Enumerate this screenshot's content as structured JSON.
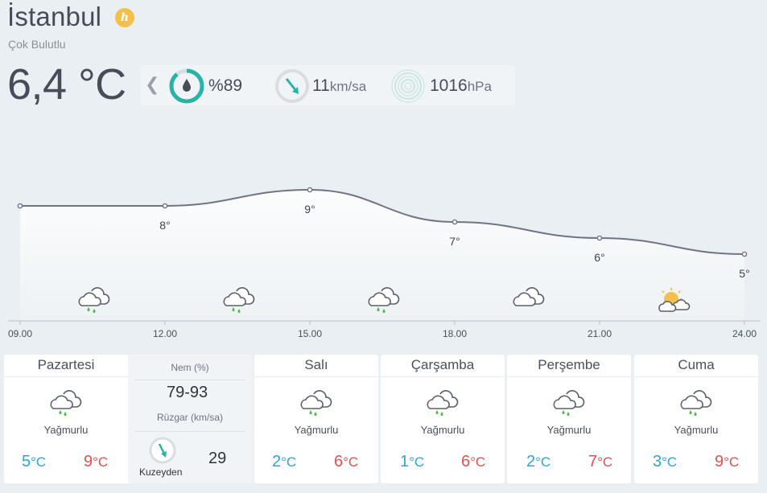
{
  "header": {
    "city": "İstanbul",
    "badge_letter": "h",
    "condition": "Çok Bulutlu",
    "temperature": "6,4 °C"
  },
  "stats": {
    "humidity": {
      "prefix": "%",
      "value": "89",
      "level": 0.89
    },
    "wind": {
      "value": "11",
      "unit": "km/sa"
    },
    "pressure": {
      "value": "1016",
      "unit": "hPa"
    }
  },
  "chart_data": {
    "type": "line",
    "x": [
      "09.00",
      "12.00",
      "15.00",
      "18.00",
      "21.00",
      "24.00"
    ],
    "values": [
      7.8,
      7.8,
      8.8,
      6.8,
      5.8,
      4.8
    ],
    "point_labels": [
      "",
      "8°",
      "9°",
      "7°",
      "6°",
      "5°"
    ],
    "icons": [
      "rain-cloud",
      "rain-cloud",
      "rain-cloud",
      "cloud",
      "partly-sunny"
    ],
    "colors": {
      "line": "#6f7584",
      "axis": "#b8c0c8",
      "rain": "#4fb847",
      "sun": "#f5c04a"
    }
  },
  "forecast": [
    {
      "day": "Pazartesi",
      "desc": "Yağmurlu",
      "low": "5",
      "high": "9",
      "unit": "°C"
    },
    {
      "day": "Salı",
      "desc": "Yağmurlu",
      "low": "2",
      "high": "6",
      "unit": "°C"
    },
    {
      "day": "Çarşamba",
      "desc": "Yağmurlu",
      "low": "1",
      "high": "6",
      "unit": "°C"
    },
    {
      "day": "Perşembe",
      "desc": "Yağmurlu",
      "low": "2",
      "high": "7",
      "unit": "°C"
    },
    {
      "day": "Cuma",
      "desc": "Yağmurlu",
      "low": "3",
      "high": "9",
      "unit": "°C"
    }
  ],
  "detail": {
    "humidity_label": "Nem (%)",
    "humidity_value": "79-93",
    "wind_label": "Rüzgar (km/sa)",
    "wind_dir": "Kuzeyden",
    "wind_value": "29"
  }
}
